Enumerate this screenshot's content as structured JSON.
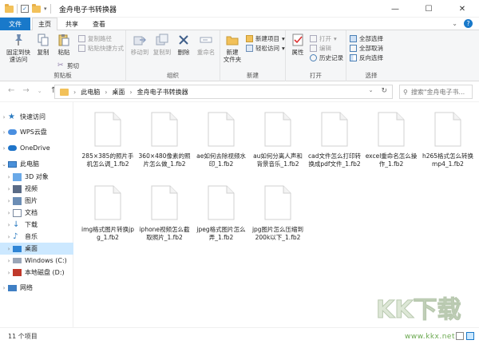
{
  "window": {
    "title": "金舟电子书转换器",
    "controls": [
      "—",
      "☐",
      "✕"
    ]
  },
  "tabs": {
    "file": "文件",
    "home": "主页",
    "share": "共享",
    "view": "查看"
  },
  "ribbon": {
    "clipboard": {
      "label": "剪贴板",
      "pin_quick": "固定到快\n速访问",
      "copy": "复制",
      "paste": "粘贴",
      "cut": "剪切",
      "copy_path": "复制路径",
      "paste_shortcut": "粘贴快捷方式"
    },
    "organize": {
      "label": "组织",
      "move_to": "移动到",
      "copy_to": "复制到",
      "delete": "删除",
      "rename": "重命名"
    },
    "new": {
      "label": "新建",
      "new_folder": "新建\n文件夹",
      "new_item": "新建项目",
      "easy_access": "轻松访问"
    },
    "open": {
      "label": "打开",
      "properties": "属性",
      "open": "打开",
      "edit": "编辑",
      "history": "历史记录"
    },
    "select": {
      "label": "选择",
      "select_all": "全部选择",
      "select_none": "全部取消",
      "invert": "反向选择"
    }
  },
  "address": {
    "crumbs": [
      "此电脑",
      "桌面",
      "金舟电子书转换器"
    ],
    "search_placeholder": "搜索\"金舟电子书..."
  },
  "sidebar": {
    "items": [
      {
        "label": "快速访问",
        "icon": "star-icon"
      },
      {
        "label": "WPS云盘",
        "icon": "cloud-icon"
      },
      {
        "label": "OneDrive",
        "icon": "onedrive-icon"
      },
      {
        "label": "此电脑",
        "icon": "computer-icon"
      },
      {
        "label": "3D 对象",
        "icon": "cube-icon"
      },
      {
        "label": "视频",
        "icon": "video-icon"
      },
      {
        "label": "图片",
        "icon": "picture-icon"
      },
      {
        "label": "文档",
        "icon": "document-icon"
      },
      {
        "label": "下载",
        "icon": "download-icon"
      },
      {
        "label": "音乐",
        "icon": "music-icon"
      },
      {
        "label": "桌面",
        "icon": "desktop-icon"
      },
      {
        "label": "Windows (C:)",
        "icon": "drive-icon"
      },
      {
        "label": "本地磁盘 (D:)",
        "icon": "drive-icon"
      },
      {
        "label": "网络",
        "icon": "network-icon"
      }
    ]
  },
  "files": [
    {
      "name": "285×385的照片手机怎么调_1.fb2"
    },
    {
      "name": "360×480像素的照片怎么做_1.fb2"
    },
    {
      "name": "ae如何去除视频水印_1.fb2"
    },
    {
      "name": "au如何分离人声和背景音乐_1.fb2"
    },
    {
      "name": "cad文件怎么打印转换成pdf文件_1.fb2"
    },
    {
      "name": "excel重命名怎么操作_1.fb2"
    },
    {
      "name": "h265格式怎么转换mp4_1.fb2"
    },
    {
      "name": "img格式图片转换jpg_1.fb2"
    },
    {
      "name": "iphone视频怎么截取照片_1.fb2"
    },
    {
      "name": "jpeg格式图片怎么弄_1.fb2"
    },
    {
      "name": "jpg图片怎么压缩到200k以下_1.fb2"
    }
  ],
  "status": {
    "count": "11 个项目"
  },
  "watermark": {
    "url": "www.kkx.net",
    "logo_text": "KK下载"
  },
  "colors": {
    "accent": "#1979ca",
    "selected": "#cce8ff",
    "folder": "#f2c15a"
  }
}
